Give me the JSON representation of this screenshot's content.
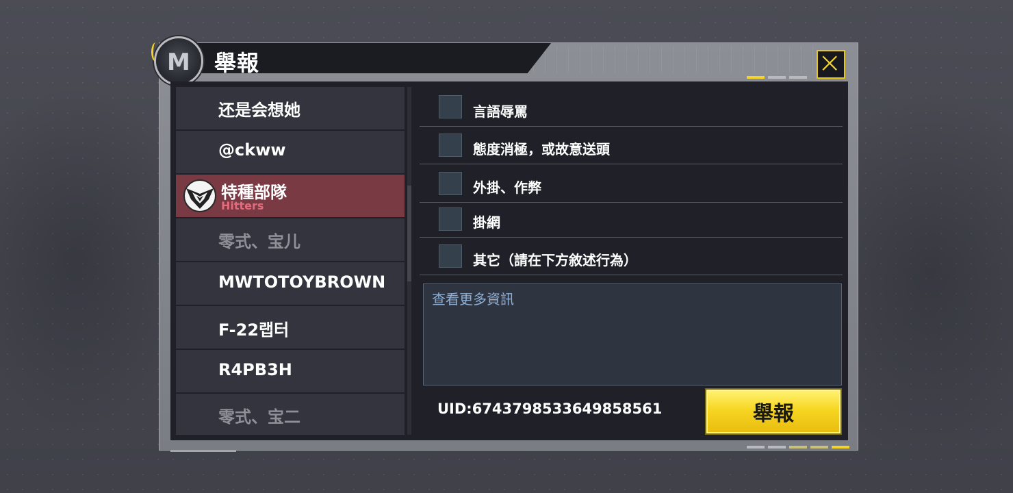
{
  "dialog": {
    "title": "舉報",
    "emblem_letter": "M",
    "close_icon": "close-x-icon",
    "accent_color": "#f2d22b"
  },
  "players": [
    {
      "name": "还是会想她",
      "state": "normal"
    },
    {
      "name": "@ckww",
      "state": "normal"
    },
    {
      "name": "特種部隊",
      "clan": "Hitters",
      "state": "selected",
      "badge": "clan-emblem-icon"
    },
    {
      "name": "零式、宝儿",
      "state": "dim"
    },
    {
      "name": "MWTOTOYBROWN",
      "state": "normal"
    },
    {
      "name": "F-22랩터",
      "state": "normal"
    },
    {
      "name": "R4PB3H",
      "state": "normal"
    },
    {
      "name": "零式、宝二",
      "state": "dim"
    }
  ],
  "options": [
    {
      "label": "言語辱罵",
      "checked": false
    },
    {
      "label": "態度消極，或故意送頭",
      "checked": false
    },
    {
      "label": "外掛、作弊",
      "checked": false
    },
    {
      "label": "掛網",
      "checked": false
    },
    {
      "label": "其它（請在下方敘述行為）",
      "checked": false
    }
  ],
  "detail": {
    "placeholder": "查看更多資訊",
    "value": ""
  },
  "uid": "UID:6743798533649858561",
  "report_button": "舉報"
}
